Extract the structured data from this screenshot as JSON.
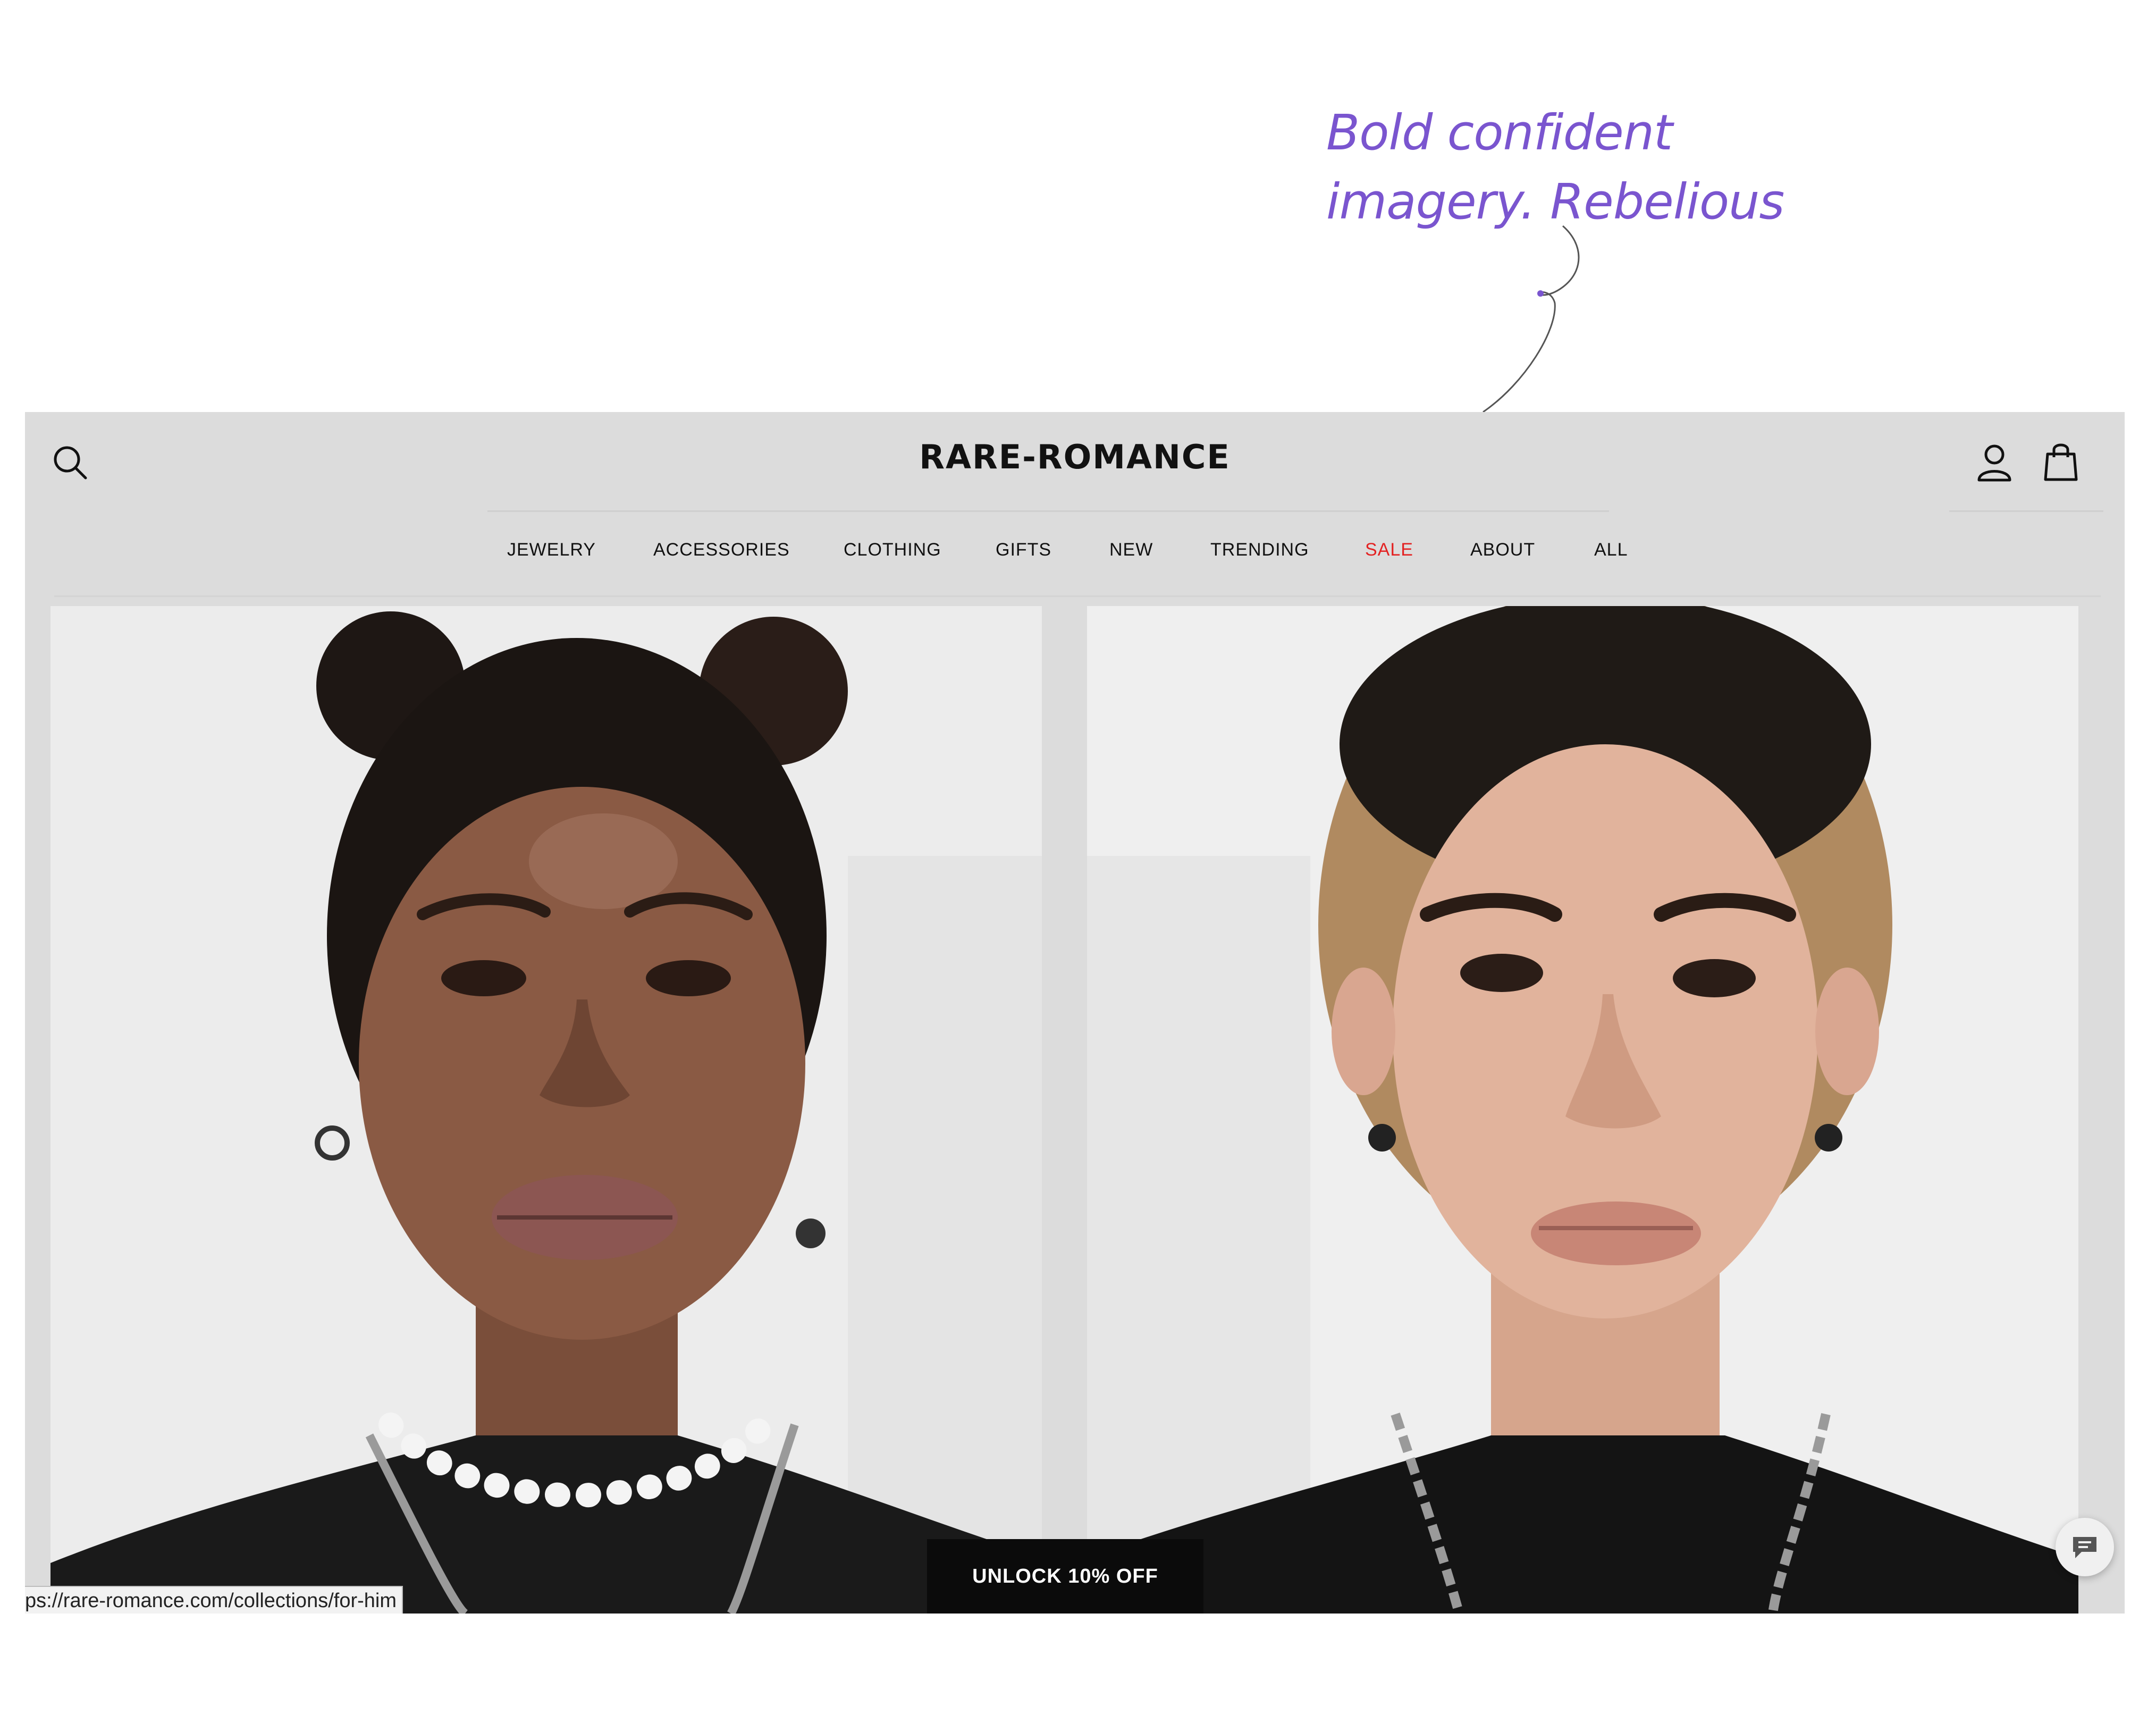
{
  "annotation": {
    "lines": [
      "Bold confident",
      "imagery. Rebelious"
    ],
    "color": "#7a55cf"
  },
  "header": {
    "logo": "RARE-ROMANCE",
    "icons": [
      "search-icon",
      "account-icon",
      "shopping-bag-icon"
    ]
  },
  "nav": {
    "items": [
      {
        "label": "JEWELRY"
      },
      {
        "label": "ACCESSORIES"
      },
      {
        "label": "CLOTHING"
      },
      {
        "label": "GIFTS"
      },
      {
        "label": "NEW"
      },
      {
        "label": "TRENDING"
      },
      {
        "label": "SALE",
        "color": "#e32222"
      },
      {
        "label": "ABOUT"
      },
      {
        "label": "ALL"
      }
    ]
  },
  "hero": {
    "images": [
      "model-portrait-woman",
      "model-portrait-man"
    ]
  },
  "promo": {
    "label": "UNLOCK 10% OFF"
  },
  "status_bar": {
    "url": "ps://rare-romance.com/collections/for-him"
  },
  "chat": {
    "icon": "chat-bubble-icon"
  }
}
